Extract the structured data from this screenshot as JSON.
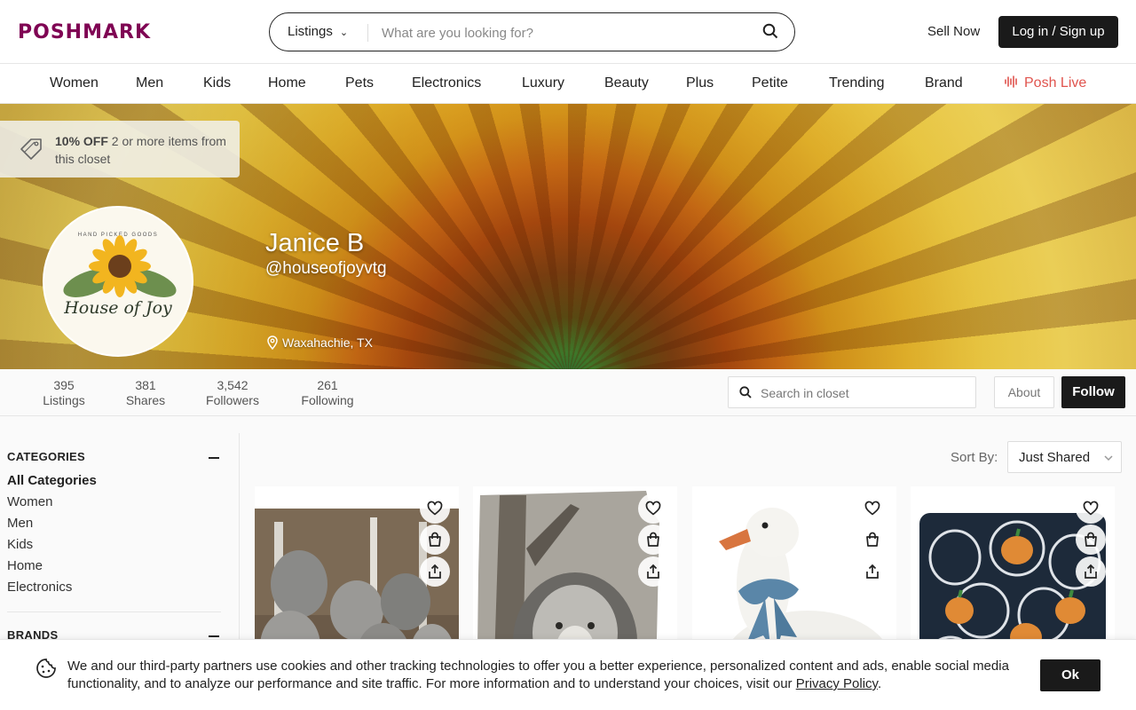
{
  "header": {
    "logo": "POSHMARK",
    "search_scope": "Listings",
    "search_placeholder": "What are you looking for?",
    "sell_now": "Sell Now",
    "login": "Log in / Sign up"
  },
  "nav": {
    "items": [
      "Women",
      "Men",
      "Kids",
      "Home",
      "Pets",
      "Electronics",
      "Luxury",
      "Beauty",
      "Plus",
      "Petite",
      "Trending",
      "Brand"
    ],
    "live": "Posh Live"
  },
  "promo": {
    "bold": "10% OFF",
    "text": " 2 or more items from this closet"
  },
  "profile": {
    "avatar_top": "HAND PICKED GOODS",
    "avatar_brand": "House of Joy",
    "name": "Janice B",
    "handle": "@houseofjoyvtg",
    "location": "Waxahachie, TX"
  },
  "stats": [
    {
      "num": "395",
      "label": "Listings"
    },
    {
      "num": "381",
      "label": "Shares"
    },
    {
      "num": "3,542",
      "label": "Followers"
    },
    {
      "num": "261",
      "label": "Following"
    }
  ],
  "closet_search_placeholder": "Search in closet",
  "about": "About",
  "follow": "Follow",
  "sidebar": {
    "categories_title": "CATEGORIES",
    "categories": [
      "All Categories",
      "Women",
      "Men",
      "Kids",
      "Home",
      "Electronics"
    ],
    "brands_title": "BRANDS"
  },
  "sort": {
    "label": "Sort By:",
    "value": "Just Shared"
  },
  "cookie": {
    "text": "We and our third-party partners use cookies and other tracking technologies to offer you a better experience, personalized content and ads, enable social media functionality, and to analyze our performance and site traffic. For more information and to understand your choices, visit our ",
    "link": "Privacy Policy",
    "end": ".",
    "ok": "Ok"
  }
}
